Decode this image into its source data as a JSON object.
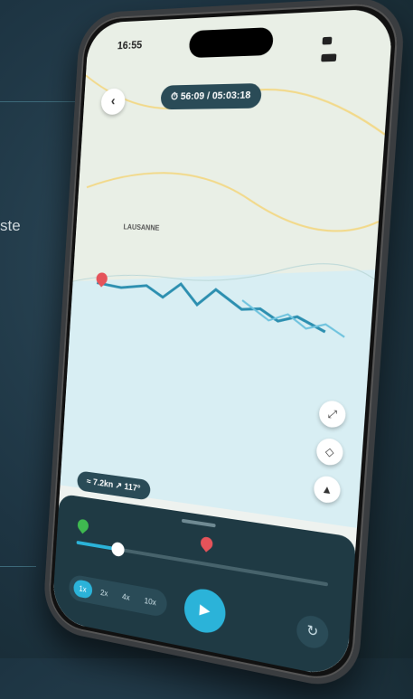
{
  "background": {
    "side_text": "ste"
  },
  "status_bar": {
    "time": "16:55"
  },
  "header": {
    "back_icon": "chevron-left-icon",
    "timer": "⏱ 56:09 / 05:03:18"
  },
  "map": {
    "labels": [
      "LAUSANNE"
    ],
    "controls": [
      {
        "name": "fullscreen-icon",
        "glyph": "⤢"
      },
      {
        "name": "layers-icon",
        "glyph": "◇"
      },
      {
        "name": "compass-icon",
        "glyph": "▲"
      }
    ],
    "route_color": "#2c8fb0",
    "start_pin_color": "#e5535a"
  },
  "stats": {
    "text": "≈ 7.2kn  ↗ 117°"
  },
  "playback": {
    "progress": 0.18,
    "speeds": [
      "1x",
      "2x",
      "4x",
      "10x"
    ],
    "active_speed": "1x",
    "play_glyph": "▶",
    "replay_glyph": "↻",
    "accent": "#2bb3d9"
  }
}
